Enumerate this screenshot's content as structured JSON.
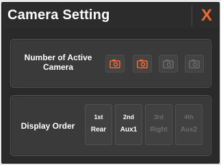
{
  "dialog": {
    "title": "Camera Setting",
    "close_label": "X"
  },
  "active_cameras": {
    "label": "Number of Active Camera",
    "buttons": [
      {
        "state": "active",
        "icon": "camera-icon"
      },
      {
        "state": "active",
        "icon": "camera-icon"
      },
      {
        "state": "inactive",
        "icon": "camera-icon"
      },
      {
        "state": "inactive",
        "icon": "camera-icon"
      }
    ]
  },
  "display_order": {
    "label": "Display Order",
    "items": [
      {
        "rank": "1st",
        "camera": "Rear",
        "state": "active"
      },
      {
        "rank": "2nd",
        "camera": "Aux1",
        "state": "active"
      },
      {
        "rank": "3rd",
        "camera": "Right",
        "state": "inactive"
      },
      {
        "rank": "4th",
        "camera": "Aux2",
        "state": "inactive"
      }
    ]
  },
  "colors": {
    "accent": "#f06a35",
    "inactive": "#6c6c6c",
    "panel": "#3a3a3a",
    "background": "#2a2a2a"
  }
}
